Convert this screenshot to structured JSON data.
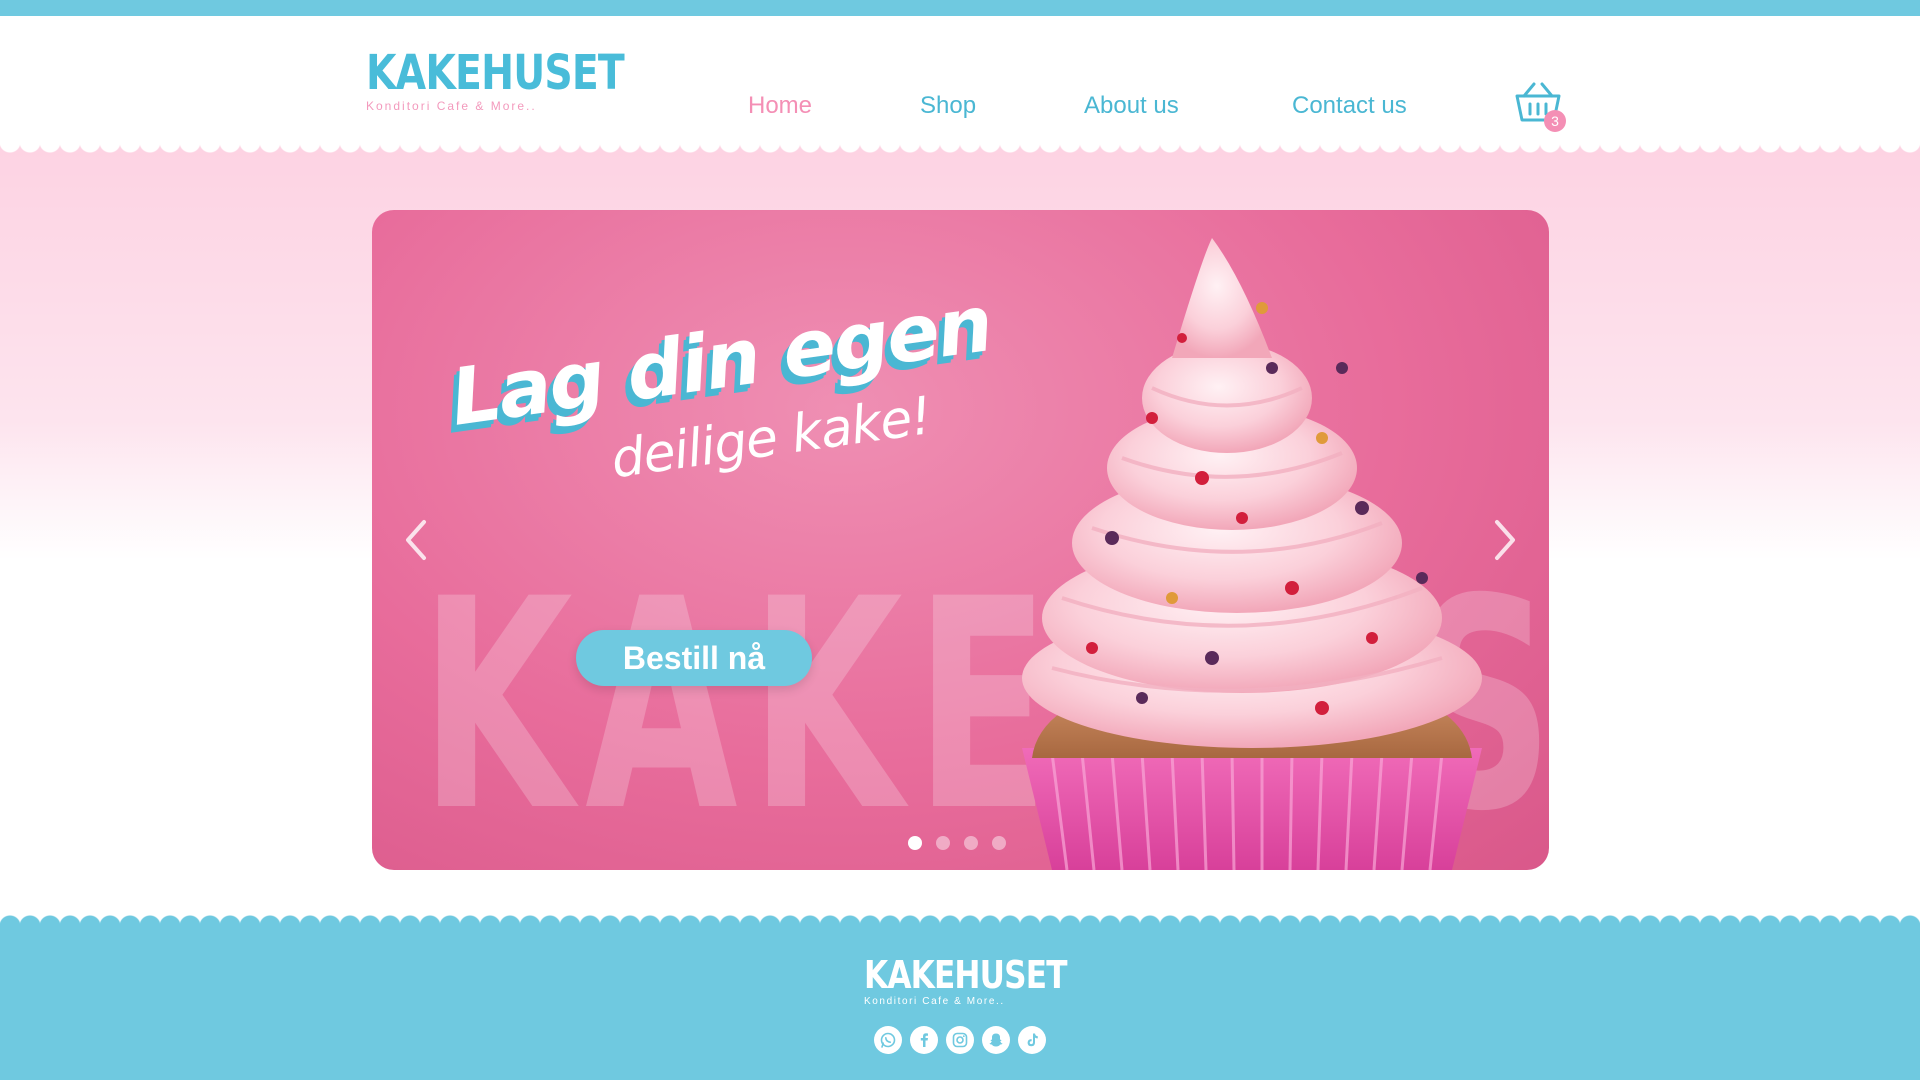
{
  "brand": {
    "name": "KAKEHUSET",
    "tagline": "Konditori Cafe & More.."
  },
  "nav": {
    "items": [
      {
        "label": "Home",
        "active": true
      },
      {
        "label": "Shop",
        "active": false
      },
      {
        "label": "About us",
        "active": false
      },
      {
        "label": "Contact us",
        "active": false
      }
    ]
  },
  "cart": {
    "count": "3",
    "icon": "basket-icon"
  },
  "hero": {
    "headline": "Lag din egen",
    "subheadline": "deilige kake!",
    "cta_label": "Bestill nå",
    "watermark": "KAKEHUSET",
    "slides_total": 4,
    "active_slide": 1
  },
  "colors": {
    "accent_blue": "#6fc9e0",
    "accent_pink": "#f48fb5",
    "hero_pink": "#e86c9b",
    "nav_blue": "#4ab7d3"
  },
  "footer": {
    "social": [
      {
        "name": "whatsapp-icon"
      },
      {
        "name": "facebook-icon"
      },
      {
        "name": "instagram-icon"
      },
      {
        "name": "snapchat-icon"
      },
      {
        "name": "tiktok-icon"
      }
    ]
  }
}
